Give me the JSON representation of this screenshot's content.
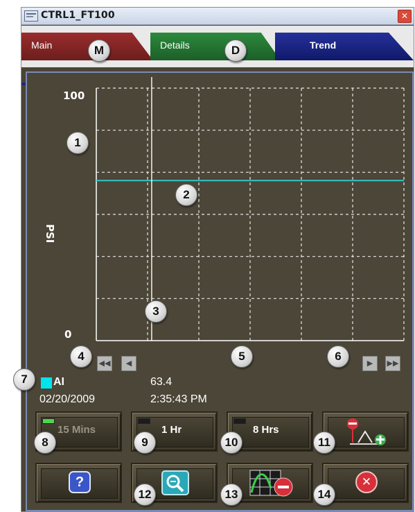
{
  "window": {
    "title": "CTRL1_FT100",
    "close_glyph": "✕"
  },
  "tabs": [
    {
      "label": "Main",
      "marker": "M",
      "color": "#8a2828"
    },
    {
      "label": "Details",
      "marker": "D",
      "color": "#26783a"
    },
    {
      "label": "Trend",
      "marker": "",
      "color": "#1d2888"
    }
  ],
  "chart_data": {
    "type": "line",
    "ylabel": "PSI",
    "xlabel": "",
    "ylim": [
      0,
      100
    ],
    "y_ticks": [
      "100",
      "0"
    ],
    "grid": true,
    "series": [
      {
        "name": "AI",
        "color": "#2ec8c8",
        "values": [
          63.4,
          63.4
        ]
      }
    ],
    "cursor_position": 0.18
  },
  "legend": {
    "name": "AI",
    "value": "63.4",
    "date": "02/20/2009",
    "time": "2:35:43 PM",
    "color": "#00e4f0"
  },
  "nav": {
    "first_icon": "double-left-arrow-icon",
    "prev_icon": "left-arrow-icon",
    "next_icon": "right-arrow-icon",
    "last_icon": "double-right-arrow-icon",
    "first_glyph": "◀◀",
    "prev_glyph": "◀",
    "next_glyph": "▶",
    "last_glyph": "▶▶"
  },
  "time_buttons": [
    {
      "label": "15 Mins",
      "active": true,
      "led_color": "#4ad84a"
    },
    {
      "label": "1 Hr",
      "active": false,
      "led_color": "#1c1c1c"
    },
    {
      "label": "8 Hrs",
      "active": false,
      "led_color": "#1c1c1c"
    }
  ],
  "tool_buttons": {
    "pens_icon": "add-remove-pen-icon",
    "help_icon": "help-icon",
    "help_glyph": "?",
    "zoom_icon": "zoom-out-icon",
    "remove_icon": "remove-trend-icon",
    "close_icon": "close-icon",
    "close_glyph": "✕"
  },
  "callouts": [
    "M",
    "D",
    "1",
    "2",
    "3",
    "4",
    "5",
    "6",
    "7",
    "8",
    "9",
    "10",
    "11",
    "12",
    "13",
    "14"
  ]
}
